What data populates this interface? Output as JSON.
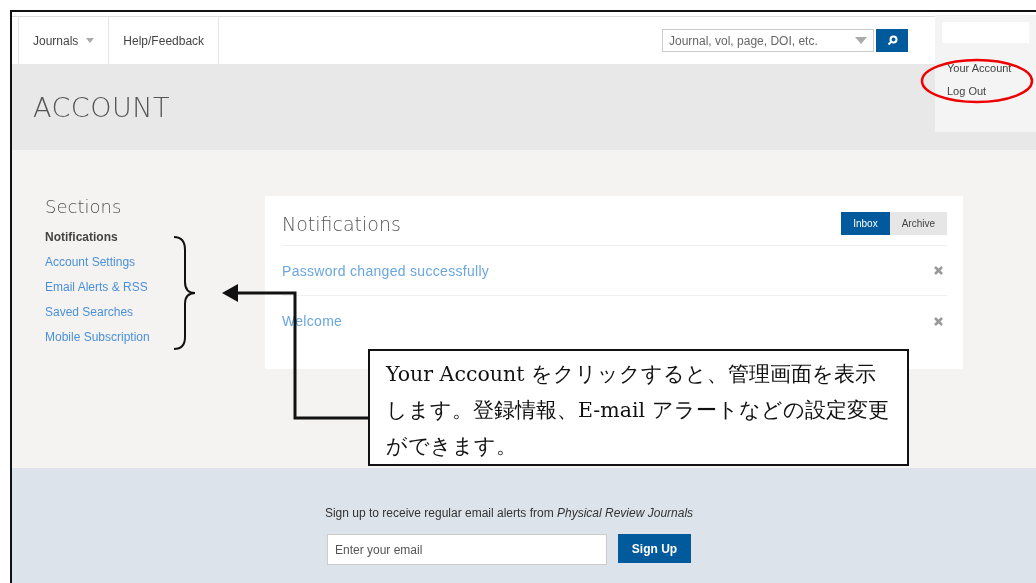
{
  "nav": {
    "items": [
      {
        "label": "Journals",
        "dropdown": true
      },
      {
        "label": "Help/Feedback",
        "dropdown": false
      }
    ],
    "search": {
      "placeholder": "Journal, vol, page, DOI, etc."
    }
  },
  "account_menu": {
    "items": [
      "Your Account",
      "Log Out"
    ]
  },
  "header": {
    "title": "ACCOUNT"
  },
  "sections": {
    "title": "Sections",
    "items": [
      {
        "label": "Notifications",
        "selected": true
      },
      {
        "label": "Account Settings",
        "selected": false
      },
      {
        "label": "Email Alerts & RSS",
        "selected": false
      },
      {
        "label": "Saved Searches",
        "selected": false
      },
      {
        "label": "Mobile Subscription",
        "selected": false
      }
    ]
  },
  "notifications": {
    "title": "Notifications",
    "tabs": [
      {
        "label": "Inbox",
        "selected": true
      },
      {
        "label": "Archive",
        "selected": false
      }
    ],
    "items": [
      "Password changed successfully",
      "Welcome"
    ]
  },
  "footer": {
    "text": "Sign up to receive regular email alerts from *Physical Review Journals*",
    "email": {
      "placeholder": "Enter your email"
    },
    "button": "Sign Up"
  },
  "annotation": {
    "text": "Your Account をクリックすると、管理画面を表示します。登録情報、E-mail アラートなどの設定変更ができます。"
  }
}
